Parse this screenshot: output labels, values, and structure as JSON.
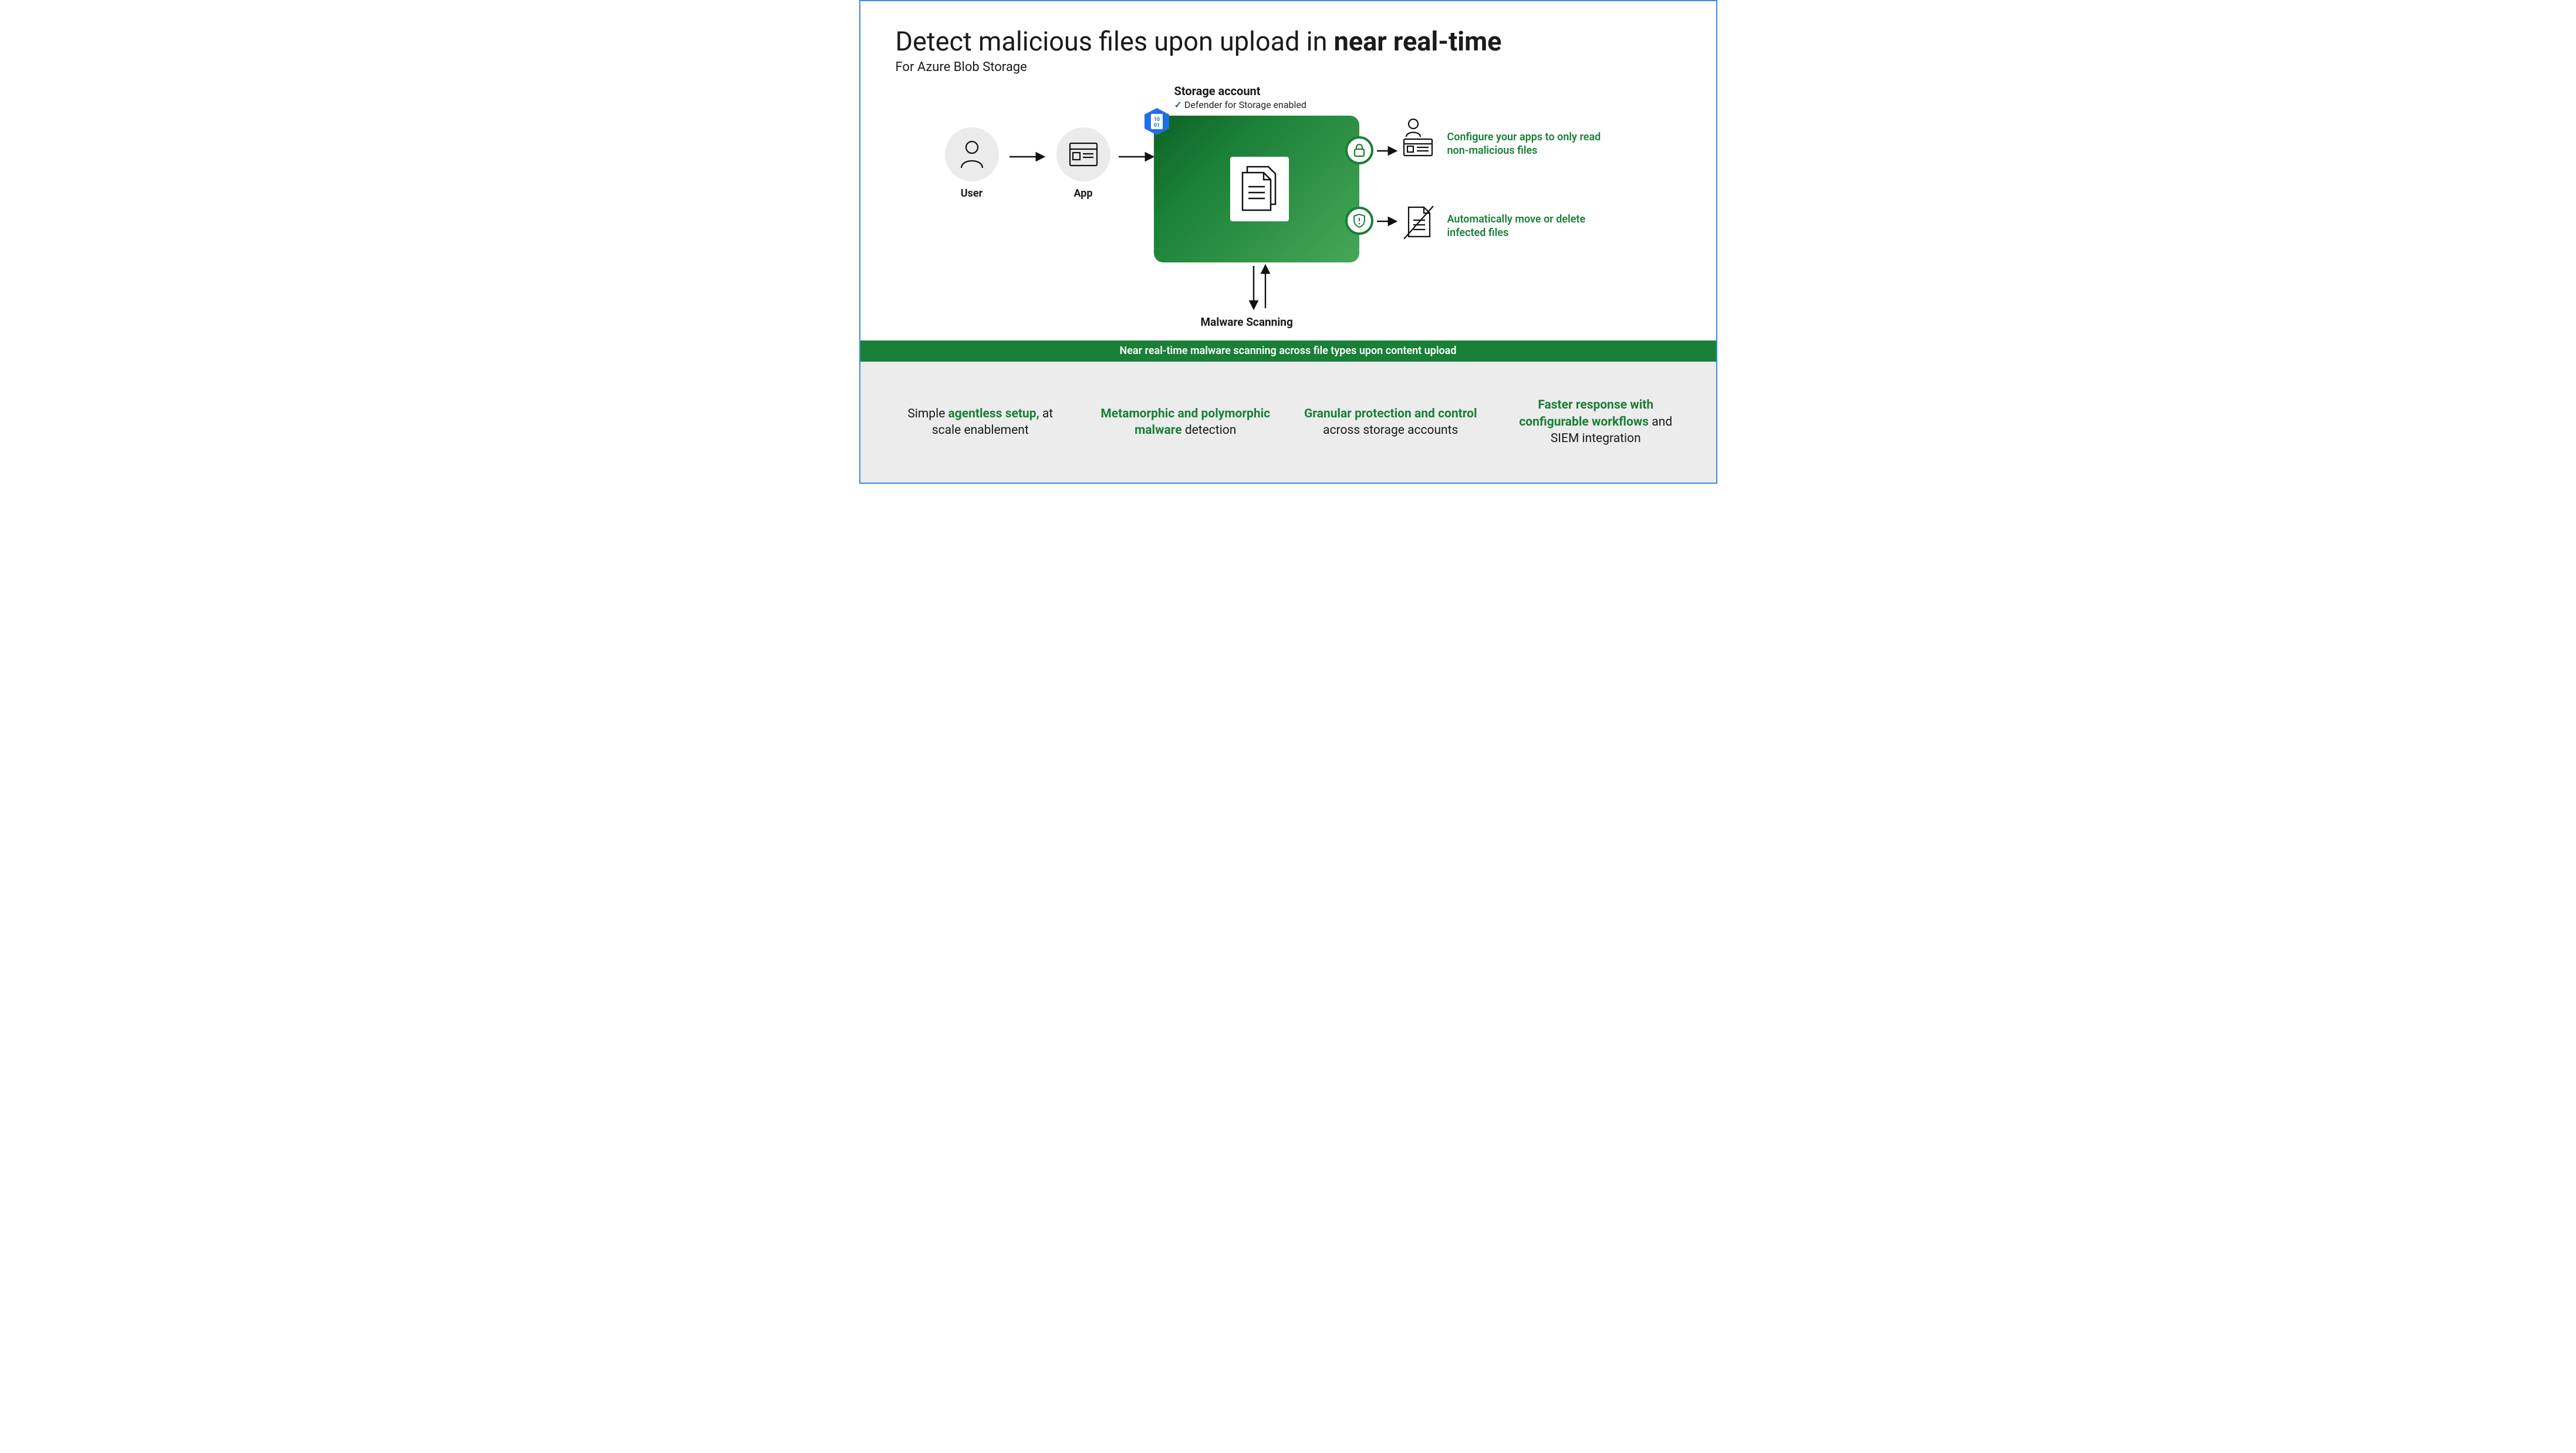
{
  "header": {
    "title_plain": "Detect malicious files upon upload in ",
    "title_bold": "near real-time",
    "subtitle": "For Azure Blob Storage"
  },
  "diagram": {
    "user_label": "User",
    "app_label": "App",
    "storage_label": "Storage account",
    "defender_text": "Defender for Storage enabled",
    "malware_label": "Malware Scanning",
    "hex_text": "10\n01",
    "outcomes": {
      "read_clean": "Configure your apps to only read non-malicious files",
      "move_delete": "Automatically move or delete infected files"
    }
  },
  "banner": "Near real-time malware scanning across file types upon content upload",
  "features": [
    {
      "pre": "Simple ",
      "green": "agentless setup,",
      "post": " at scale enablement"
    },
    {
      "pre": "",
      "green": "Metamorphic and polymorphic malware",
      "post": " detection"
    },
    {
      "pre": "",
      "green": "Granular protection and control",
      "post": " across storage accounts"
    },
    {
      "pre": "",
      "green": "Faster response with configurable workflows",
      "post": " and SIEM integration"
    }
  ]
}
